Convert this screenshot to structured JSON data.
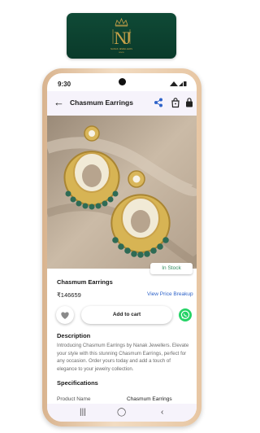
{
  "brand": {
    "monogram": "NJ",
    "name": "NANAK JEWELLERS",
    "tagline": "SINCE",
    "accent": "#c9a24a",
    "background": "#0c3f2f"
  },
  "status_bar": {
    "time": "9:30"
  },
  "app_bar": {
    "title": "Chasmum Earrings",
    "back_icon": "arrow-left-icon",
    "share_icon": "share-icon",
    "bag_icon": "shopping-bag-icon",
    "lock_icon": "lock-bag-icon"
  },
  "product": {
    "stock_badge": "In Stock",
    "name": "Chasmum Earrings",
    "price": "₹146659",
    "price_breakup_link": "View Price Breakup"
  },
  "actions": {
    "wishlist_icon": "heart-icon",
    "add_to_cart": "Add to cart",
    "whatsapp_icon": "whatsapp-icon"
  },
  "description": {
    "heading": "Description",
    "text": "Introducing Chasmum Earrings by Nanak Jewellers. Elevate your style with this stunning Chasmum Earrings, perfect for any occasion. Order yours today and add a touch of elegance to your jewelry collection."
  },
  "specifications": {
    "heading": "Specifications",
    "rows": [
      {
        "key": "Product Name",
        "value": "Chasmum Earrings"
      }
    ]
  },
  "nav": {
    "recents": "|||",
    "home": "◯",
    "back": "‹"
  },
  "colors": {
    "link": "#2e63c9",
    "in_stock": "#2f8b5c",
    "whatsapp": "#25d366"
  }
}
